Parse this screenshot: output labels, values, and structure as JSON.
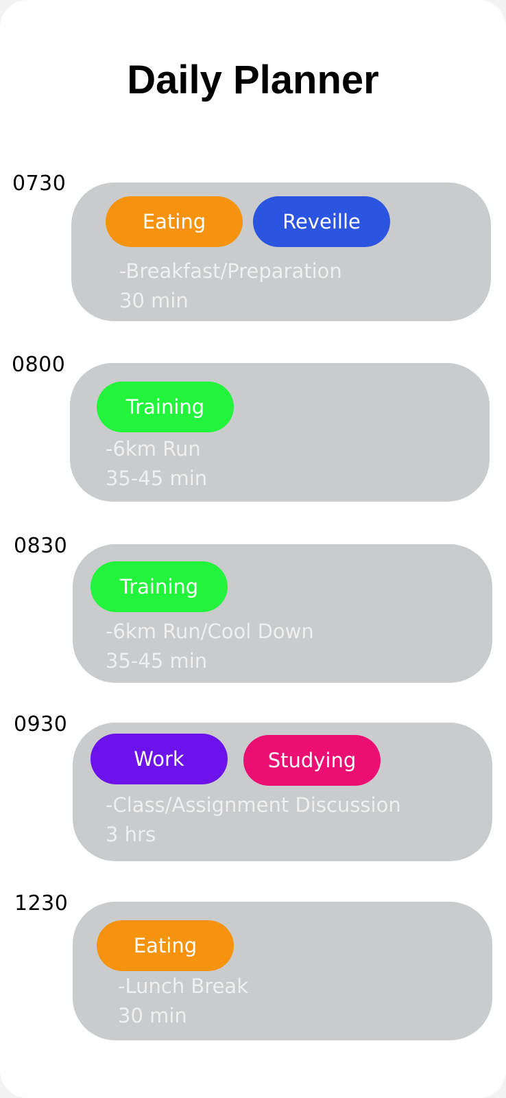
{
  "app": {
    "title": "Daily Planner"
  },
  "colors": {
    "eating": "#f5930f",
    "reveille": "#2b55e0",
    "training": "#22f43b",
    "work": "#6c12ea",
    "studying": "#ec0f73",
    "card": "#c9cbcc"
  },
  "entries": [
    {
      "time": "0730",
      "tags": [
        {
          "label": "Eating",
          "color": "eating"
        },
        {
          "label": "Reveille",
          "color": "reveille"
        }
      ],
      "description": "-Breakfast/Preparation",
      "duration": "30 min"
    },
    {
      "time": "0800",
      "tags": [
        {
          "label": "Training",
          "color": "training"
        }
      ],
      "description": "-6km Run",
      "duration": "35-45 min"
    },
    {
      "time": "0830",
      "tags": [
        {
          "label": "Training",
          "color": "training"
        }
      ],
      "description": "-6km Run/Cool Down",
      "duration": "35-45 min"
    },
    {
      "time": "0930",
      "tags": [
        {
          "label": "Work",
          "color": "work"
        },
        {
          "label": "Studying",
          "color": "studying"
        }
      ],
      "description": "-Class/Assignment Discussion",
      "duration": "3 hrs"
    },
    {
      "time": "1230",
      "tags": [
        {
          "label": "Eating",
          "color": "eating"
        }
      ],
      "description": "-Lunch Break",
      "duration": "30 min"
    }
  ]
}
